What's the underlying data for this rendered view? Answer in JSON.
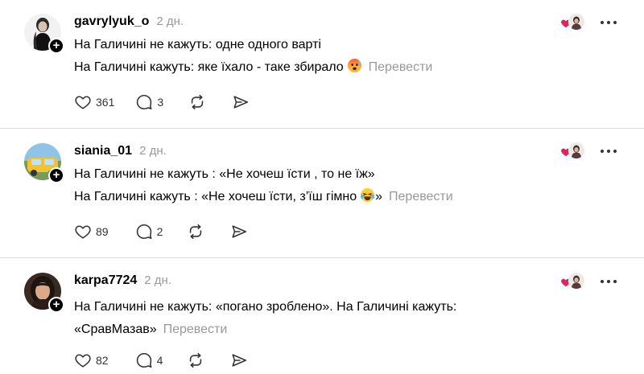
{
  "posts": [
    {
      "username": "gavrylyuk_o",
      "time": "2 дн.",
      "lines": [
        "На Галичині не кажуть: одне одного варті",
        "На Галичині кажуть: яке їхало - таке збирало"
      ],
      "emoji": "hot-face-emoji",
      "translate": "Перевести",
      "likes": "361",
      "replies": "3"
    },
    {
      "username": "siania_01",
      "time": "2 дн.",
      "lines": [
        "На Галичині не кажуть : «Не хочеш їсти , то не їж»",
        "На Галичині кажуть : «Не хочеш їсти, з’їш гімно"
      ],
      "line2_suffix": "»",
      "emoji": "laughing-tears-emoji",
      "translate": "Перевести",
      "likes": "89",
      "replies": "2"
    },
    {
      "username": "karpa7724",
      "time": "2 дн.",
      "lines": [
        "На Галичині не кажуть: «погано зроблено». На Галичині кажуть:",
        "«СравМазав»"
      ],
      "translate": "Перевести",
      "likes": "82",
      "replies": "4"
    }
  ],
  "icons": {
    "like": "heart-outline-icon",
    "reply": "speech-bubble-icon",
    "repost": "repost-arrows-icon",
    "share": "send-arrow-icon",
    "more": "more-dots-icon",
    "follow": "plus-icon"
  },
  "colors": {
    "text": "#000000",
    "muted": "#999999",
    "divider": "#dbdbdb",
    "liked_heart": "#e0245e"
  }
}
